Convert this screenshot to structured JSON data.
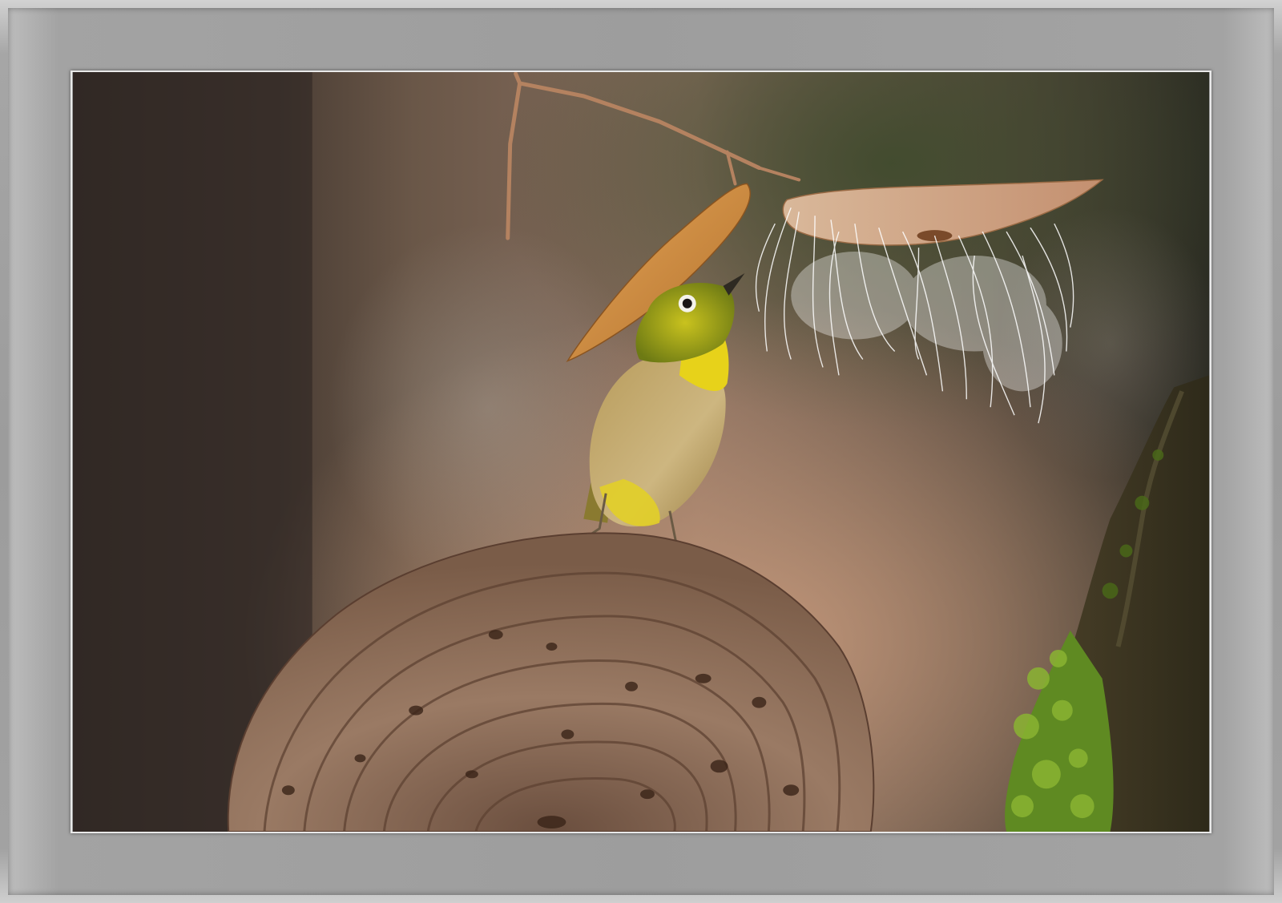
{
  "image": {
    "subject": "",
    "colors": {
      "frame": "#9c9c9c",
      "mat_border": "#e9e9e9",
      "bird_green": "#7a8f1a",
      "bird_yellow": "#e7d21a",
      "bird_belly": "#c9b070",
      "leaf_orange": "#c98a3a",
      "fungus_brown": "#8a6a54",
      "moss_green": "#5f8a22",
      "background_dark": "#2e2824",
      "background_warm": "#b08a70"
    }
  }
}
